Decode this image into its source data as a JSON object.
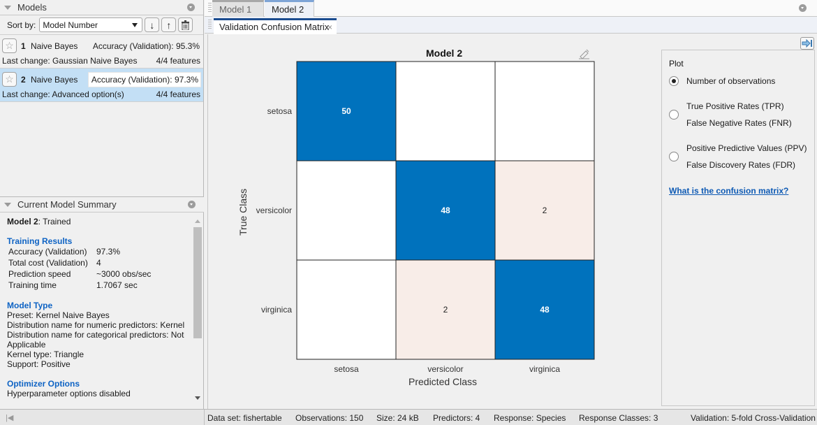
{
  "models_panel": {
    "title": "Models",
    "sort_label": "Sort by:",
    "sort_value": "Model Number",
    "models": [
      {
        "number": "1",
        "type": "Naive Bayes",
        "accuracy": "Accuracy (Validation): 95.3%",
        "last_change": "Last change: Gaussian Naive Bayes",
        "features": "4/4 features",
        "selected": false
      },
      {
        "number": "2",
        "type": "Naive Bayes",
        "accuracy": "Accuracy (Validation): 97.3%",
        "last_change": "Last change: Advanced option(s)",
        "features": "4/4 features",
        "selected": true
      }
    ]
  },
  "summary_panel": {
    "title": "Current Model Summary",
    "model_name": "Model 2",
    "status": ": Trained",
    "training_results": {
      "heading": "Training Results",
      "rows": [
        {
          "key": "Accuracy (Validation)",
          "value": "97.3%"
        },
        {
          "key": "Total cost (Validation)",
          "value": "4"
        },
        {
          "key": "Prediction speed",
          "value": "~3000 obs/sec"
        },
        {
          "key": "Training time",
          "value": "1.7067 sec"
        }
      ]
    },
    "model_type": {
      "heading": "Model Type",
      "lines": [
        "Preset: Kernel Naive Bayes",
        "Distribution name for numeric predictors: Kernel",
        "Distribution name for categorical predictors: Not",
        "Applicable",
        "Kernel type: Triangle",
        "Support: Positive"
      ]
    },
    "optimizer": {
      "heading": "Optimizer Options",
      "lines": [
        "Hyperparameter options disabled"
      ]
    }
  },
  "doc_tabs": [
    {
      "label": "Model 1",
      "active": false
    },
    {
      "label": "Model 2",
      "active": true
    }
  ],
  "figure_tab": {
    "label": "Validation Confusion Matrix",
    "close": "×"
  },
  "chart_data": {
    "type": "heatmap",
    "title": "Model 2",
    "xlabel": "Predicted Class",
    "ylabel": "True Class",
    "categories": [
      "setosa",
      "versicolor",
      "virginica"
    ],
    "values": [
      [
        50,
        0,
        0
      ],
      [
        0,
        48,
        2
      ],
      [
        0,
        2,
        48
      ]
    ],
    "colors": {
      "diagonal": "#0072bd",
      "off_diagonal_nonzero": "#f8ede8",
      "zero": "#ffffff"
    }
  },
  "options_panel": {
    "title": "Plot",
    "radios": [
      {
        "lines": [
          "Number of observations"
        ],
        "checked": true
      },
      {
        "lines": [
          "True Positive Rates (TPR)",
          "False Negative Rates (FNR)"
        ],
        "checked": false
      },
      {
        "lines": [
          "Positive Predictive Values (PPV)",
          "False Discovery Rates (FDR)"
        ],
        "checked": false
      }
    ],
    "help_link": "What is the confusion matrix?"
  },
  "status_bar": {
    "items": [
      "Data set: fishertable",
      "Observations: 150",
      "Size: 24 kB",
      "Predictors: 4",
      "Response: Species",
      "Response Classes: 3",
      "Validation: 5-fold Cross-Validation"
    ]
  }
}
